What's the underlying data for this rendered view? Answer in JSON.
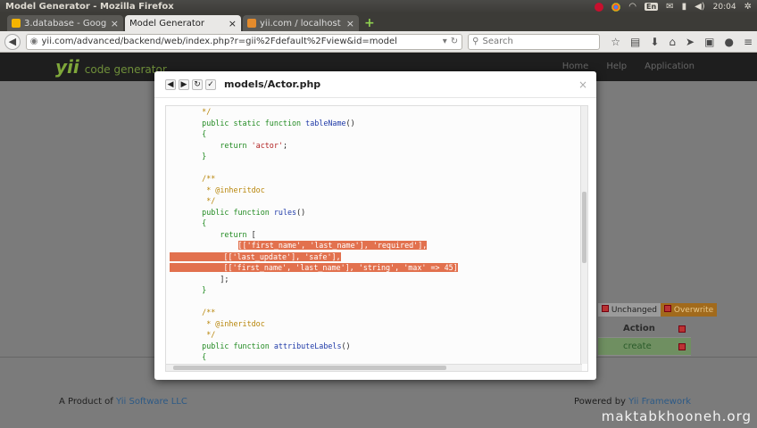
{
  "os": {
    "window_title": "Model Generator - Mozilla Firefox",
    "keyboard_layout": "En",
    "clock": "20:04"
  },
  "tabs": [
    {
      "label": "3.database - Google ...",
      "favicon_color": "#f4b400",
      "active": false
    },
    {
      "label": "Model Generator",
      "favicon_color": "",
      "active": true
    },
    {
      "label": "yii.com / localhost / ...",
      "favicon_color": "#e48b2c",
      "active": false
    }
  ],
  "nav": {
    "url": "yii.com/advanced/backend/web/index.php?r=gii%2Fdefault%2Fview&id=model",
    "search_placeholder": "Search"
  },
  "site": {
    "logo": "yii",
    "logo_sub": "code generator",
    "nav_items": [
      "Home",
      "Help",
      "Application"
    ],
    "legend_unchanged": "Unchanged",
    "legend_overwrite": "Overwrite",
    "table_header": "Action",
    "table_action": "create",
    "footer_left_prefix": "A Product of ",
    "footer_left_link": "Yii Software LLC",
    "footer_right_prefix": "Powered by ",
    "footer_right_link": "Yii Framework"
  },
  "watermark": "maktabkhooneh.org",
  "modal": {
    "title": "models/Actor.php",
    "close": "×",
    "code_lines": [
      {
        "indent": "    ",
        "parts": [
          {
            "t": "*/",
            "c": "cm"
          }
        ]
      },
      {
        "indent": "    ",
        "parts": [
          {
            "t": "public static function ",
            "c": "kw"
          },
          {
            "t": "tableName",
            "c": "fn"
          },
          {
            "t": "()",
            "c": "pl"
          }
        ]
      },
      {
        "indent": "    ",
        "parts": [
          {
            "t": "{",
            "c": "kw"
          }
        ]
      },
      {
        "indent": "        ",
        "parts": [
          {
            "t": "return ",
            "c": "kw"
          },
          {
            "t": "'actor'",
            "c": "st"
          },
          {
            "t": ";",
            "c": "pl"
          }
        ]
      },
      {
        "indent": "    ",
        "parts": [
          {
            "t": "}",
            "c": "kw"
          }
        ]
      },
      {
        "indent": "",
        "parts": []
      },
      {
        "indent": "    ",
        "parts": [
          {
            "t": "/**",
            "c": "cm"
          }
        ]
      },
      {
        "indent": "     ",
        "parts": [
          {
            "t": "* @inheritdoc",
            "c": "cm"
          }
        ]
      },
      {
        "indent": "     ",
        "parts": [
          {
            "t": "*/",
            "c": "cm"
          }
        ]
      },
      {
        "indent": "    ",
        "parts": [
          {
            "t": "public function ",
            "c": "kw"
          },
          {
            "t": "rules",
            "c": "fn"
          },
          {
            "t": "()",
            "c": "pl"
          }
        ]
      },
      {
        "indent": "    ",
        "parts": [
          {
            "t": "{",
            "c": "kw"
          }
        ]
      },
      {
        "indent": "        ",
        "parts": [
          {
            "t": "return ",
            "c": "kw"
          },
          {
            "t": "[",
            "c": "pl"
          }
        ]
      },
      {
        "indent": "            ",
        "parts": [
          {
            "t": "[['first_name', 'last_name'], 'required'],",
            "c": "sel"
          }
        ]
      },
      {
        "indent": "",
        "parts": [
          {
            "t": "            [['last_update'], 'safe'],",
            "c": "sel"
          }
        ]
      },
      {
        "indent": "",
        "parts": [
          {
            "t": "            [['first_name', 'last_name'], 'string', 'max' => 45]",
            "c": "sel"
          }
        ]
      },
      {
        "indent": "        ",
        "parts": [
          {
            "t": "];",
            "c": "pl"
          }
        ]
      },
      {
        "indent": "    ",
        "parts": [
          {
            "t": "}",
            "c": "kw"
          }
        ]
      },
      {
        "indent": "",
        "parts": []
      },
      {
        "indent": "    ",
        "parts": [
          {
            "t": "/**",
            "c": "cm"
          }
        ]
      },
      {
        "indent": "     ",
        "parts": [
          {
            "t": "* @inheritdoc",
            "c": "cm"
          }
        ]
      },
      {
        "indent": "     ",
        "parts": [
          {
            "t": "*/",
            "c": "cm"
          }
        ]
      },
      {
        "indent": "    ",
        "parts": [
          {
            "t": "public function ",
            "c": "kw"
          },
          {
            "t": "attributeLabels",
            "c": "fn"
          },
          {
            "t": "()",
            "c": "pl"
          }
        ]
      },
      {
        "indent": "    ",
        "parts": [
          {
            "t": "{",
            "c": "kw"
          }
        ]
      }
    ]
  }
}
